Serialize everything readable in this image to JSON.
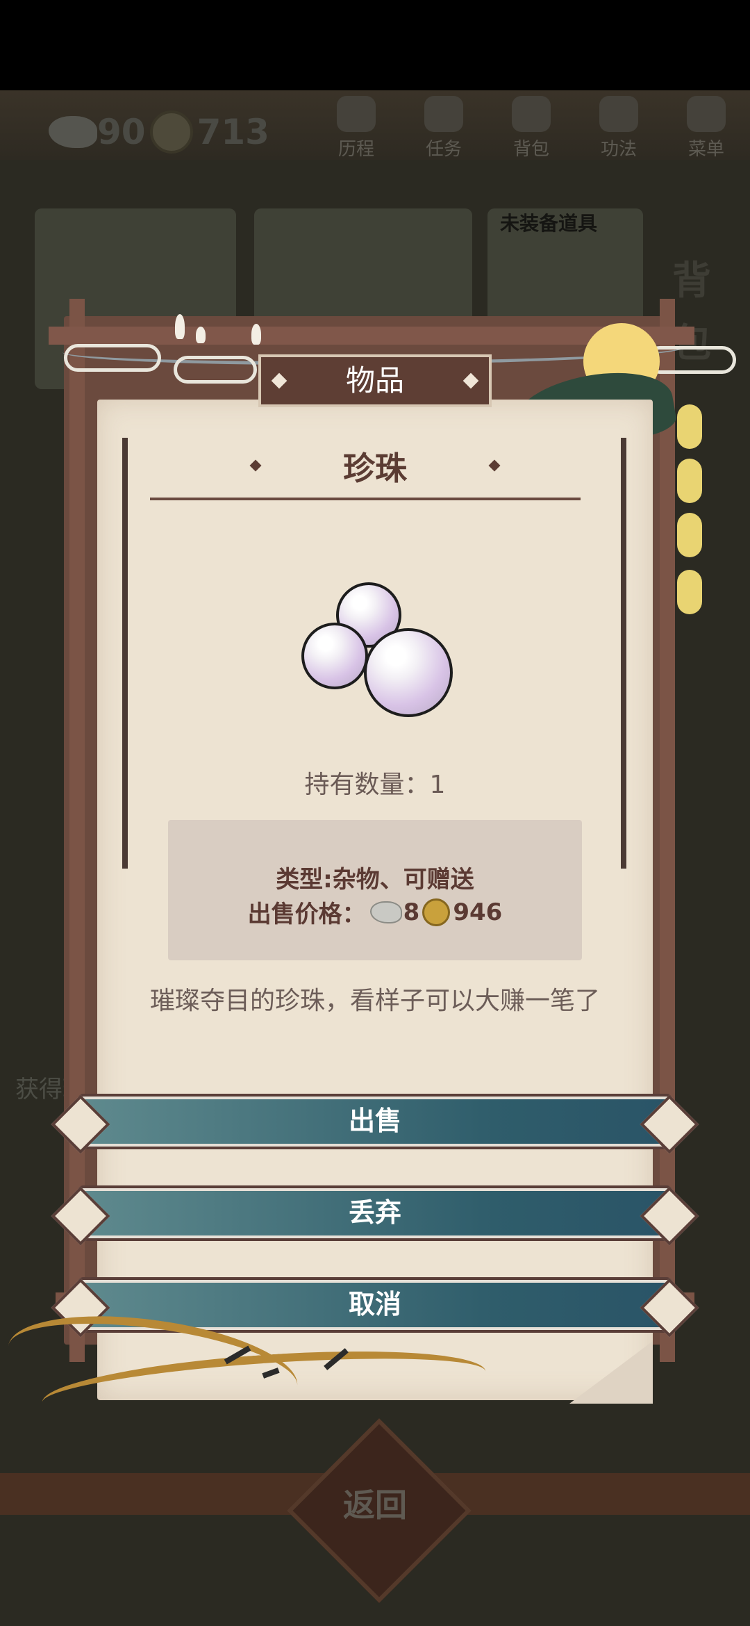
{
  "topbar": {
    "silver": "90",
    "coins": "713",
    "nav": [
      {
        "label": "历程",
        "icon": "journey-icon"
      },
      {
        "label": "任务",
        "icon": "task-icon"
      },
      {
        "label": "背包",
        "icon": "bag-icon"
      },
      {
        "label": "功法",
        "icon": "skill-icon"
      },
      {
        "label": "菜单",
        "icon": "menu-icon"
      }
    ]
  },
  "background": {
    "slot_label": "未装备道具",
    "side_title": "背包",
    "notice": "获得珍珠",
    "back_label": "返回"
  },
  "dialog": {
    "banner": "物品",
    "item_name": "珍珠",
    "item_icon": "pearl-icon",
    "quantity": "持有数量：1",
    "type": "类型:杂物、可赠送",
    "price_label": "出售价格：",
    "price_silver": "8",
    "price_coins": "946",
    "description": "璀璨夺目的珍珠，看样子可以大赚一笔了",
    "buttons": {
      "sell": "出售",
      "discard": "丢弃",
      "cancel": "取消"
    }
  },
  "colors": {
    "paper": "#ede3d2",
    "frame": "#6b4a3e",
    "button": "#2f5d6b",
    "title_text": "#5b3c33"
  }
}
